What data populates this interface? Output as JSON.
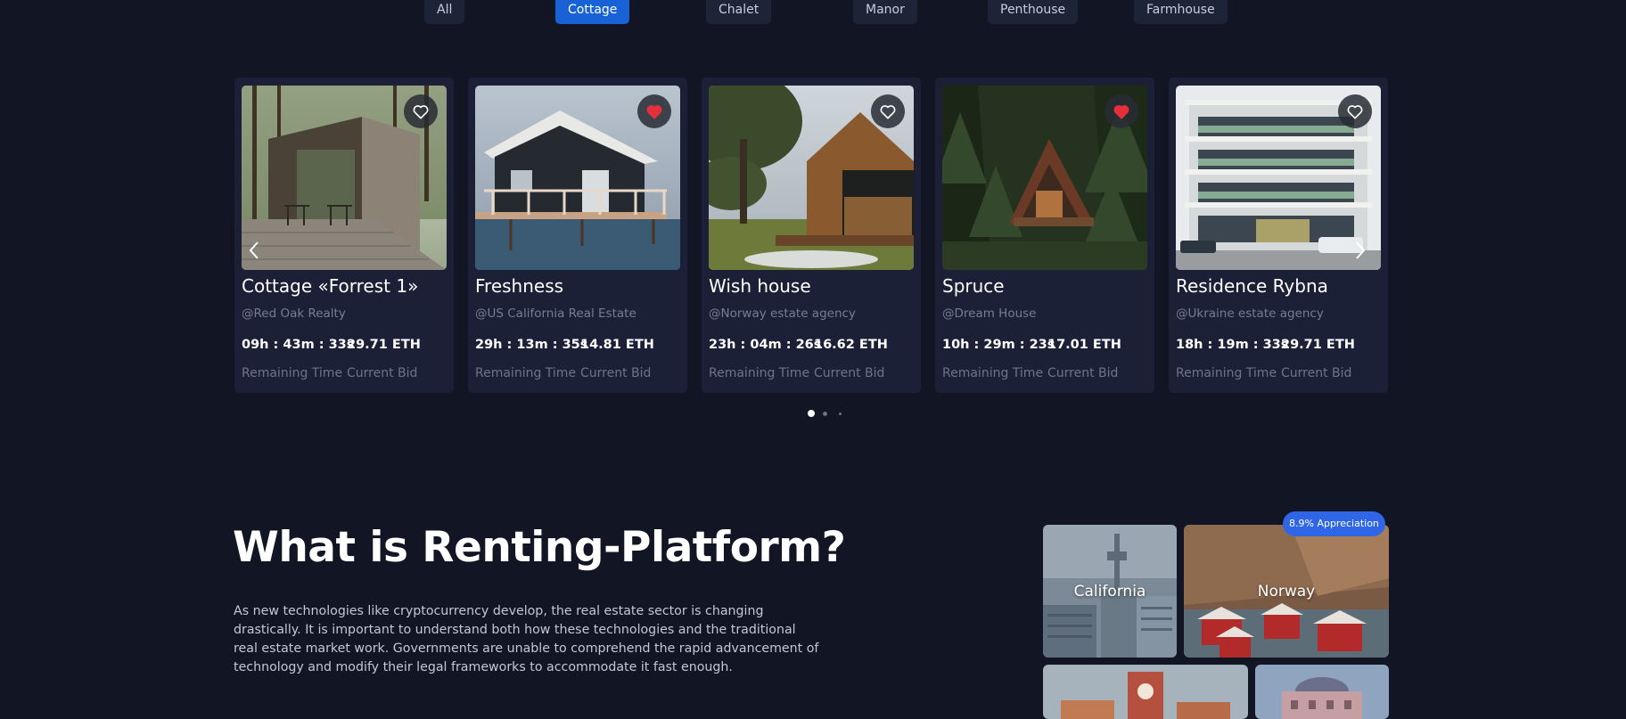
{
  "filters": {
    "tabs": [
      {
        "label": "All",
        "active": false
      },
      {
        "label": "Cottage",
        "active": true
      },
      {
        "label": "Chalet",
        "active": false
      },
      {
        "label": "Manor",
        "active": false
      },
      {
        "label": "Penthouse",
        "active": false
      },
      {
        "label": "Farmhouse",
        "active": false
      }
    ]
  },
  "listings": {
    "time_label": "Remaining Time",
    "bid_label": "Current Bid",
    "cards": [
      {
        "title": "Cottage «Forrest 1»",
        "agency": "@Red Oak Realty",
        "time": "09h : 43m : 33s",
        "bid": "29.71 ETH",
        "favorited": false
      },
      {
        "title": "Freshness",
        "agency": "@US California Real Estate",
        "time": "29h : 13m : 35s",
        "bid": "14.81 ETH",
        "favorited": true
      },
      {
        "title": "Wish house",
        "agency": "@Norway estate agency",
        "time": "23h : 04m : 26s",
        "bid": "16.62 ETH",
        "favorited": false
      },
      {
        "title": "Spruce",
        "agency": "@Dream House",
        "time": "10h : 29m : 23s",
        "bid": "17.01 ETH",
        "favorited": true
      },
      {
        "title": "Residence Rybna",
        "agency": "@Ukraine estate agency",
        "time": "18h : 19m : 33s",
        "bid": "29.71 ETH",
        "favorited": false
      }
    ],
    "pagination": {
      "pages": 3,
      "current": 1
    }
  },
  "about": {
    "title": "What is Renting-Platform?",
    "text": "As new technologies like cryptocurrency develop, the real estate sector is changing drastically. It is important to understand both how these technologies and the traditional real estate market work. Governments are unable to comprehend the rapid advancement of technology and modify their legal frameworks to accommodate it fast enough."
  },
  "locations": {
    "badge": "8.9% Appreciation",
    "tiles": [
      {
        "label": "California"
      },
      {
        "label": "Norway"
      },
      {
        "label": ""
      },
      {
        "label": ""
      }
    ]
  },
  "colors": {
    "background": "#111524",
    "card": "#1b2036",
    "accent": "#1862d6",
    "heart_active": "#e5303c",
    "badge": "#2f66e8"
  },
  "icons": {
    "favorite": "heart-icon",
    "prev": "chevron-left-icon",
    "next": "chevron-right-icon"
  }
}
